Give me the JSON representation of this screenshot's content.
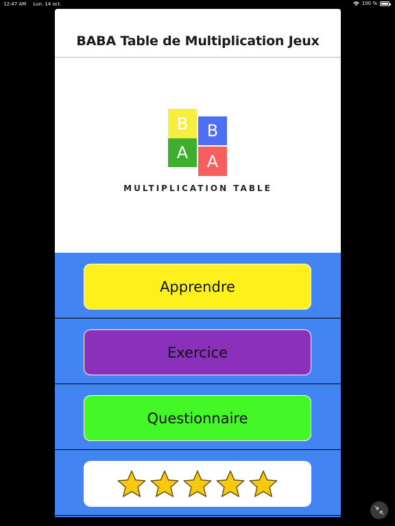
{
  "status_bar": {
    "time": "12:47 AM",
    "date": "Lun. 14 oct.",
    "battery": "100 %"
  },
  "app": {
    "title": "BABA Table de Multiplication Jeux",
    "logo": {
      "letters": [
        "B",
        "B",
        "A",
        "A"
      ],
      "colors": {
        "yellow": "#f7ef3f",
        "blue": "#4d6ef5",
        "green": "#3fae2f",
        "red": "#f65f5e"
      },
      "caption": "MULTIPLICATION TABLE"
    },
    "menu": {
      "background": "#4384f3",
      "buttons": [
        {
          "label": "Apprendre",
          "color": "#fdf01c"
        },
        {
          "label": "Exercice",
          "color": "#8b30bb"
        },
        {
          "label": "Questionnaire",
          "color": "#44f828"
        }
      ],
      "rating": {
        "stars": 5,
        "star_color": "#f8c80c",
        "icon": "star-icon"
      }
    }
  },
  "overlay": {
    "icon": "collapse-arrows-icon"
  }
}
